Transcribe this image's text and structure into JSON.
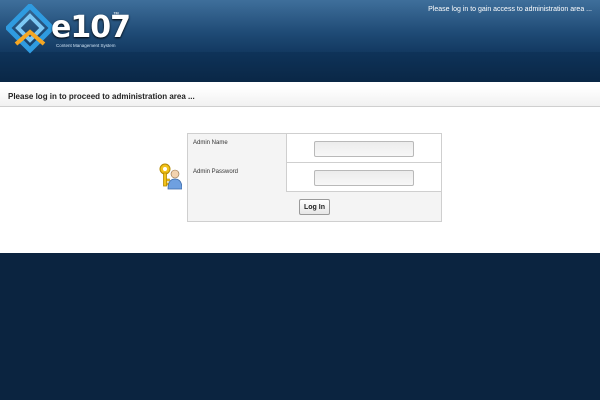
{
  "header": {
    "logo_text": "e107",
    "logo_tm": "™",
    "logo_subtitle": "Content Management System",
    "message": "Please log in to gain access to administration area ..."
  },
  "page": {
    "title": "Please log in to proceed to administration area ..."
  },
  "login_form": {
    "admin_name_label": "Admin Name",
    "admin_name_value": "",
    "admin_password_label": "Admin Password",
    "admin_password_value": "",
    "login_button_label": "Log In"
  },
  "icons": {
    "logo_icon": "e107-logo-icon",
    "login_icon": "key-user-icon"
  },
  "colors": {
    "background": "#0b2440",
    "header_top": "#3f6f9b",
    "content_bg": "#ffffff",
    "border": "#cfcfcf"
  }
}
